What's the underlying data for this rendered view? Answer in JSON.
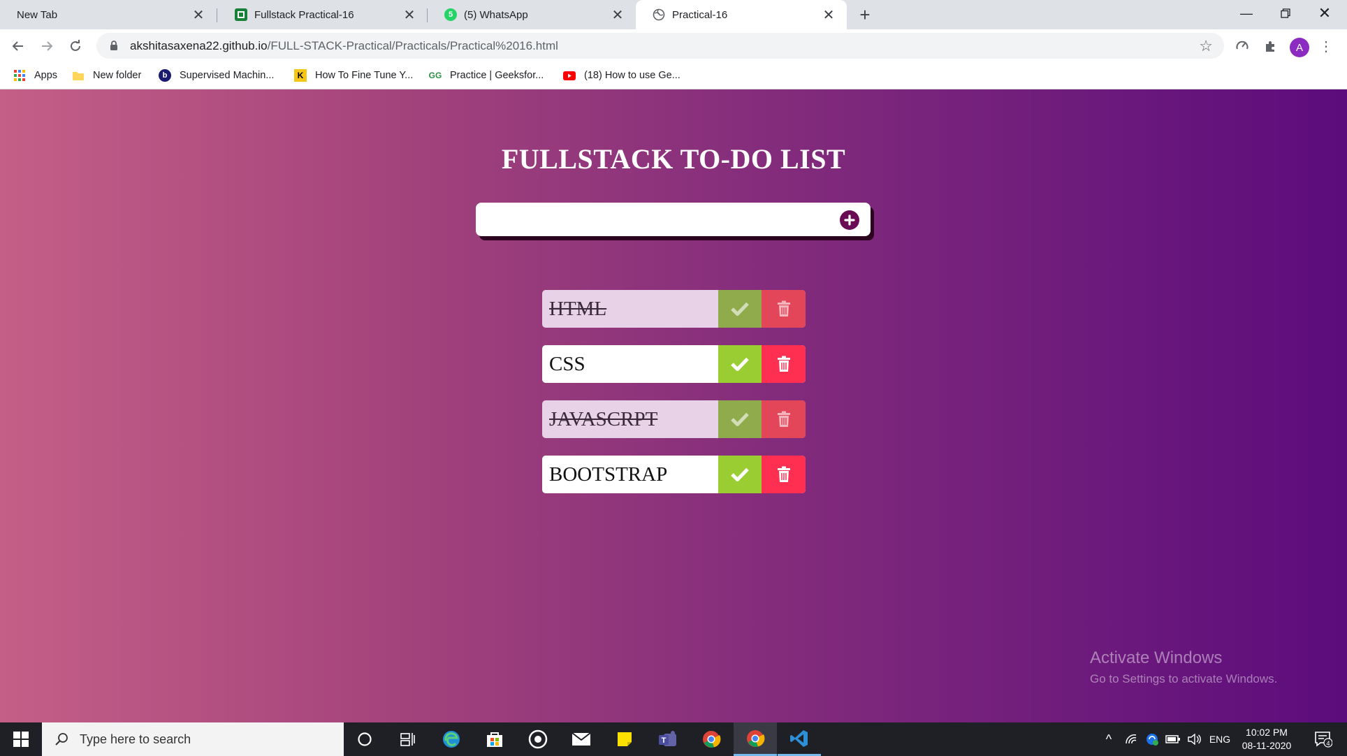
{
  "browser": {
    "tabs": [
      {
        "label": "New Tab",
        "active": false
      },
      {
        "label": "Fullstack Practical-16",
        "active": false
      },
      {
        "label": "(5) WhatsApp",
        "active": false
      },
      {
        "label": "Practical-16",
        "active": true
      }
    ],
    "url_host": "akshitasaxena22.github.io",
    "url_path": "/FULL-STACK-Practical/Practicals/Practical%2016.html",
    "profile_initial": "A",
    "bookmarks": [
      {
        "label": "Apps",
        "icon": "apps-grid-icon"
      },
      {
        "label": "New folder",
        "icon": "folder-icon"
      },
      {
        "label": "Supervised Machin...",
        "icon": "b-logo-icon"
      },
      {
        "label": "How To Fine Tune Y...",
        "icon": "k-logo-icon"
      },
      {
        "label": "Practice | Geeksfor...",
        "icon": "gfg-logo-icon"
      },
      {
        "label": "(18) How to use Ge...",
        "icon": "youtube-icon"
      }
    ]
  },
  "app": {
    "title": "FULLSTACK TO-DO LIST",
    "input_value": "",
    "todos": [
      {
        "text": "HTML",
        "done": true
      },
      {
        "text": "CSS",
        "done": false
      },
      {
        "text": "JAVASCRPT",
        "done": true
      },
      {
        "text": "BOOTSTRAP",
        "done": false
      }
    ]
  },
  "watermark": {
    "title": "Activate Windows",
    "subtitle": "Go to Settings to activate Windows."
  },
  "taskbar": {
    "search_placeholder": "Type here to search",
    "language": "ENG",
    "time": "10:02 PM",
    "date": "08-11-2020",
    "notification_count": "4"
  },
  "colors": {
    "gradient_left": "#c45f87",
    "gradient_right": "#5c0c7c",
    "check_green": "#9acd32",
    "delete_red": "#ff2f51",
    "add_button": "#6a0c54"
  }
}
